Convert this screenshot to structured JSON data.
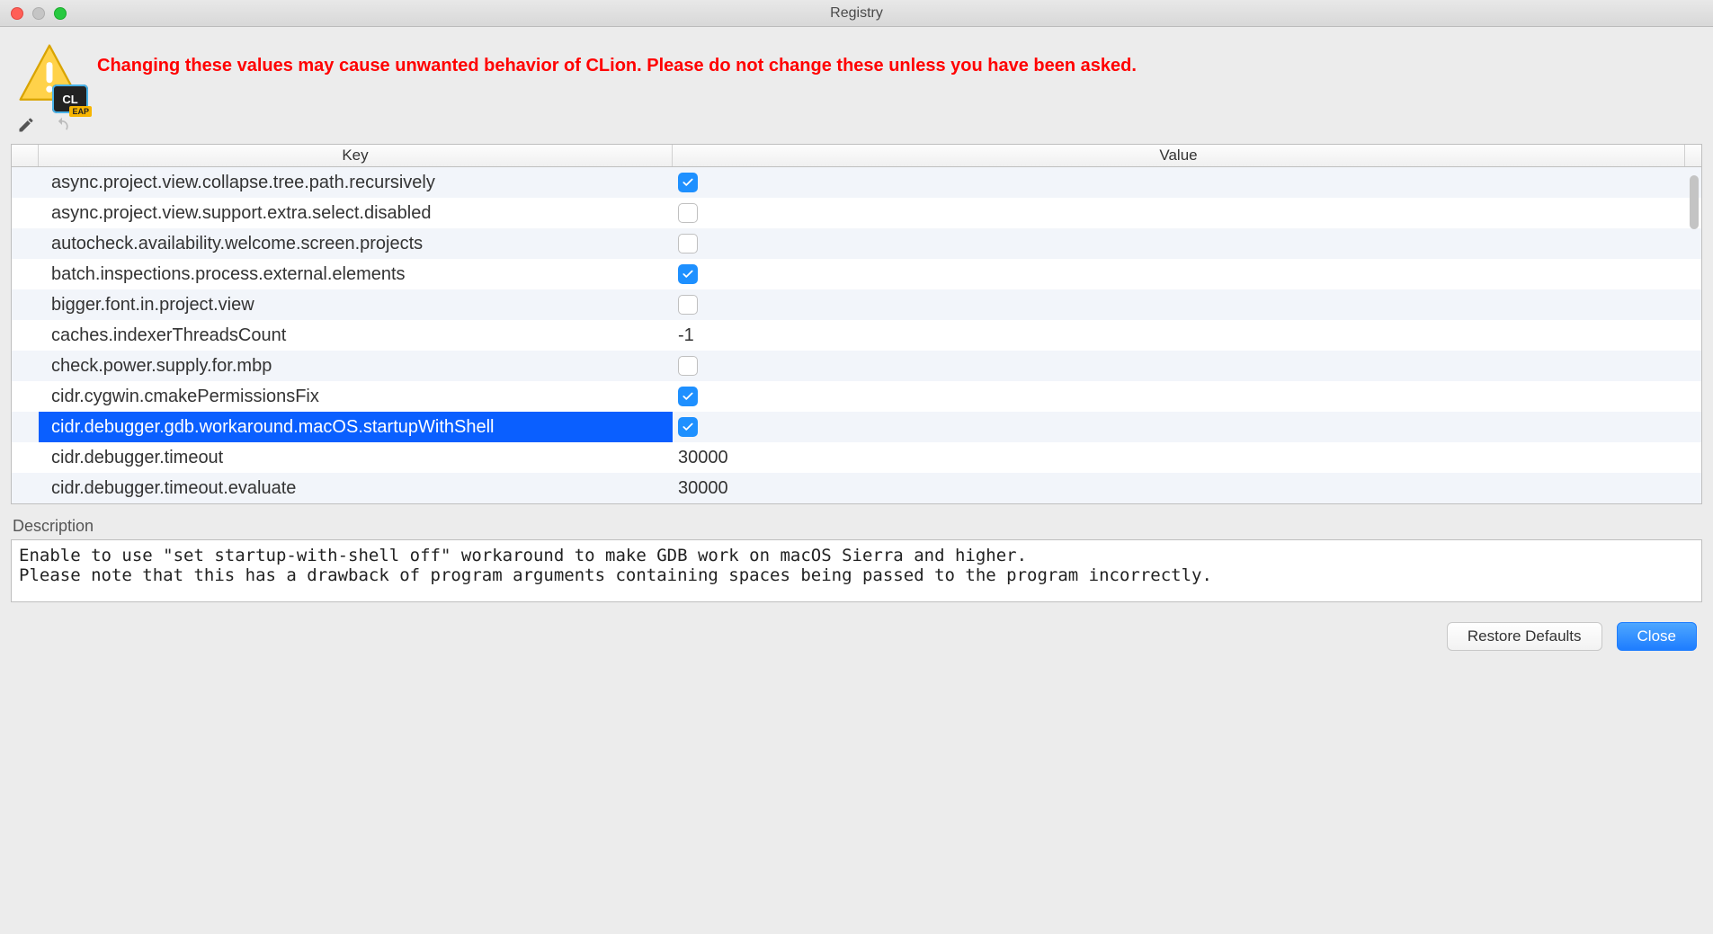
{
  "window": {
    "title": "Registry"
  },
  "header": {
    "product_badge": "CL",
    "product_badge_sub": "EAP",
    "warning": "Changing these values may cause unwanted behavior of CLion. Please do not change these unless you have been asked."
  },
  "table": {
    "columns": {
      "key": "Key",
      "value": "Value"
    },
    "rows": [
      {
        "key": "async.project.view.collapse.tree.path.recursively",
        "type": "bool",
        "value": true,
        "selected": false
      },
      {
        "key": "async.project.view.support.extra.select.disabled",
        "type": "bool",
        "value": false,
        "selected": false
      },
      {
        "key": "autocheck.availability.welcome.screen.projects",
        "type": "bool",
        "value": false,
        "selected": false
      },
      {
        "key": "batch.inspections.process.external.elements",
        "type": "bool",
        "value": true,
        "selected": false
      },
      {
        "key": "bigger.font.in.project.view",
        "type": "bool",
        "value": false,
        "selected": false
      },
      {
        "key": "caches.indexerThreadsCount",
        "type": "text",
        "value": "-1",
        "selected": false
      },
      {
        "key": "check.power.supply.for.mbp",
        "type": "bool",
        "value": false,
        "selected": false
      },
      {
        "key": "cidr.cygwin.cmakePermissionsFix",
        "type": "bool",
        "value": true,
        "selected": false
      },
      {
        "key": "cidr.debugger.gdb.workaround.macOS.startupWithShell",
        "type": "bool",
        "value": true,
        "selected": true
      },
      {
        "key": "cidr.debugger.timeout",
        "type": "text",
        "value": "30000",
        "selected": false
      },
      {
        "key": "cidr.debugger.timeout.evaluate",
        "type": "text",
        "value": "30000",
        "selected": false
      }
    ]
  },
  "description": {
    "label": "Description",
    "text": "Enable to use \"set startup-with-shell off\" workaround to make GDB work on macOS Sierra and higher.\nPlease note that this has a drawback of program arguments containing spaces being passed to the program incorrectly."
  },
  "footer": {
    "restore": "Restore Defaults",
    "close": "Close"
  }
}
